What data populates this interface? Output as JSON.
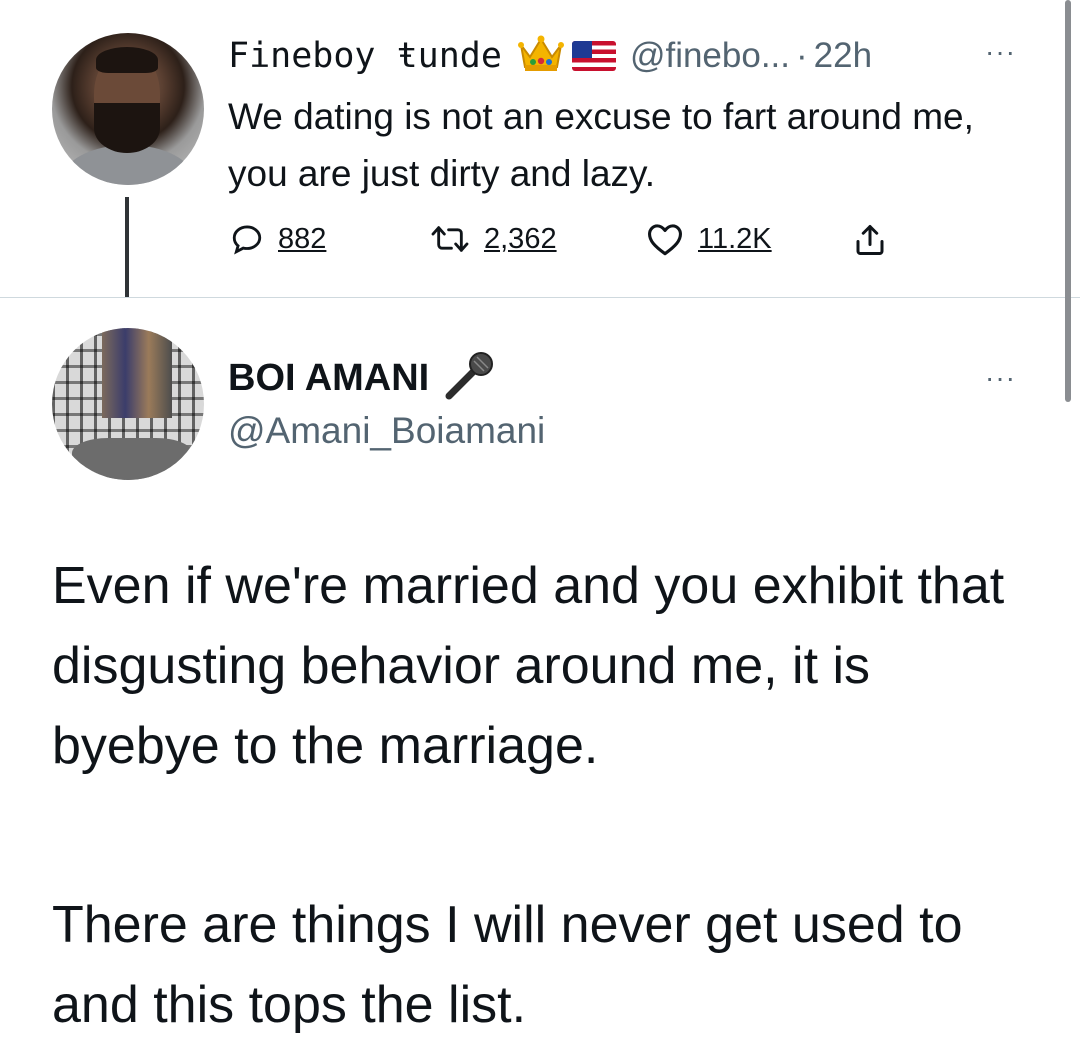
{
  "parent_tweet": {
    "author_name": "Fineboy ŧunde",
    "badges": [
      "crown-emoji",
      "us-flag-emoji"
    ],
    "handle": "@finebo...",
    "separator": "·",
    "time": "22h",
    "more": "···",
    "text": "We dating is not an excuse to fart around me, you are just dirty and lazy.",
    "actions": {
      "replies": "882",
      "retweets": "2,362",
      "likes": "11.2K"
    },
    "icons": [
      "reply-icon",
      "retweet-icon",
      "like-icon",
      "share-icon"
    ]
  },
  "reply_tweet": {
    "author_name": "BOI AMANI",
    "name_emoji": "microphone-emoji",
    "handle": "@Amani_Boiamani",
    "more": "···",
    "paragraph_1": "Even if we're married and you exhibit that disgusting behavior around me, it is byebye to the marriage.",
    "paragraph_2": "There are things I will never get used to and this tops the list."
  },
  "colors": {
    "text_primary": "#0f1419",
    "text_secondary": "#536471",
    "divider": "#cfd9de",
    "thread_line": "#2f3336"
  }
}
